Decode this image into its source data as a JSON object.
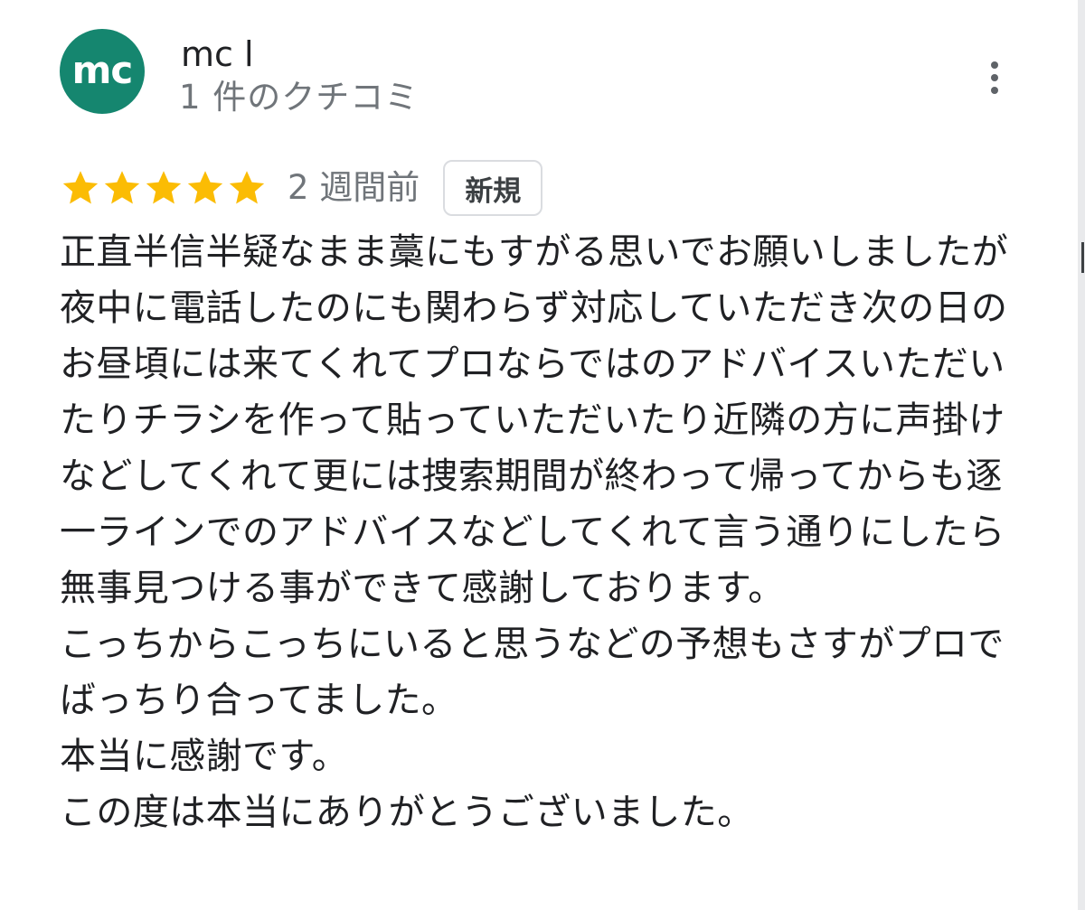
{
  "review": {
    "author": {
      "initials": "mc",
      "name": "mc l",
      "review_count": "1 件のクチコミ",
      "avatar_color": "#15866f"
    },
    "menu_icon": "more-vert-icon",
    "rating": {
      "stars": 5,
      "max": 5,
      "star_color": "#fbbc04"
    },
    "time_ago": "2 週間前",
    "badge": "新規",
    "text": "正直半信半疑なまま藁にもすがる思いでお願いしましたが夜中に電話したのにも関わらず対応していただき次の日のお昼頃には来てくれてプロならではのアドバイスいただいたりチラシを作って貼っていただいたり近隣の方に声掛けなどしてくれて更には捜索期間が終わって帰ってからも逐一ラインでのアドバイスなどしてくれて言う通りにしたら無事見つける事ができて感謝しております。\nこっちからこっちにいると思うなどの予想もさすがプロでばっちり合ってました。\n本当に感謝です。\nこの度は本当にありがとうございました。"
  }
}
